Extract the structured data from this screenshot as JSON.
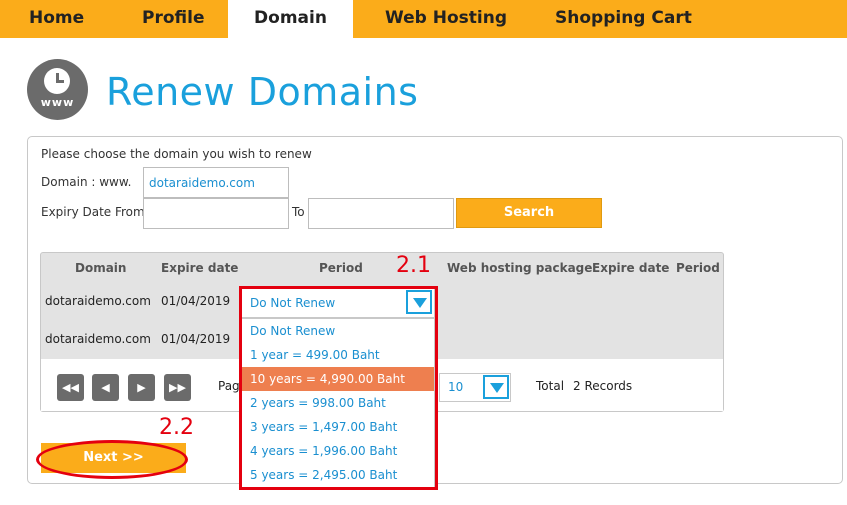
{
  "nav": {
    "items": [
      "Home",
      "Profile",
      "Domain",
      "Web Hosting",
      "Shopping Cart"
    ],
    "active": "Domain"
  },
  "header": {
    "logo_text": "www",
    "title": "Renew Domains"
  },
  "form": {
    "instruction": "Please choose the domain you wish to renew",
    "domain_label": "Domain : www.",
    "domain_value": "dotaraidemo.com",
    "expiry_from_label": "Expiry Date From",
    "expiry_from_value": "",
    "to_label": "To",
    "to_value": "",
    "search_label": "Search"
  },
  "table": {
    "headers": [
      "Domain",
      "Expire date",
      "Period",
      "Web hosting package",
      "Expire date",
      "Period"
    ],
    "rows": [
      {
        "domain": "dotaraidemo.com",
        "expire": "01/04/2019"
      },
      {
        "domain": "dotaraidemo.com",
        "expire": "01/04/2019"
      }
    ]
  },
  "period_select": {
    "selected": "Do Not Renew",
    "options": [
      "Do Not Renew",
      "1 year = 499.00 Baht",
      "10 years = 4,990.00 Baht",
      "2 years = 998.00 Baht",
      "3 years = 1,497.00 Baht",
      "4 years = 1,996.00 Baht",
      "5 years = 2,495.00 Baht"
    ],
    "highlighted_index": 2
  },
  "pager": {
    "first": "◀◀",
    "prev": "◀",
    "next": "▶",
    "last": "▶▶",
    "page_label_partial": "Pag",
    "page_size": "10",
    "total_label": "Total",
    "total_value": "2 Records"
  },
  "actions": {
    "next_label": "Next >>"
  },
  "annotations": {
    "step_1": "2.1",
    "step_2": "2.2"
  },
  "colors": {
    "nav_bg": "#fbac1a",
    "title": "#1aa0dc",
    "highlight": "#ee7f4f",
    "annotation": "#e4000f"
  }
}
